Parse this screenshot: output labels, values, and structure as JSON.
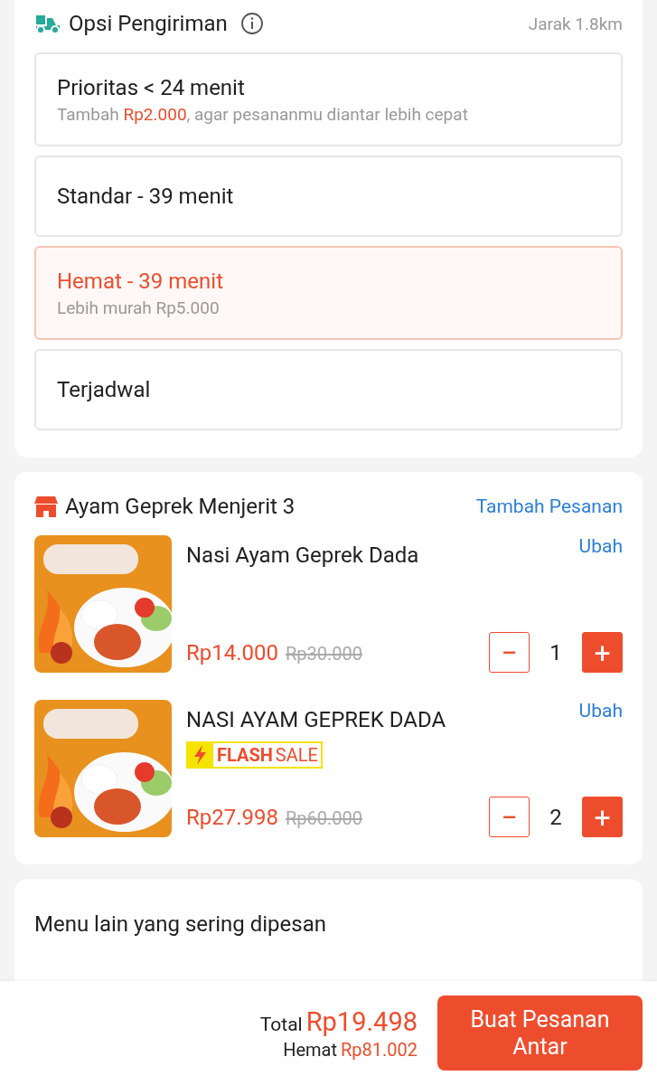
{
  "delivery": {
    "title": "Opsi Pengiriman",
    "distance": "Jarak 1.8km",
    "options": [
      {
        "title": "Prioritas < 24 menit",
        "subtitle": "Tambah **Rp2.000**, agar pesananmu diantar lebih cepat",
        "selected": false
      },
      {
        "title": "Standar - 39 menit",
        "selected": false
      },
      {
        "title": "Hemat - 39 menit",
        "subtitle": "Lebih murah Rp5.000",
        "selected": true
      },
      {
        "title": "Terjadwal",
        "selected": false
      }
    ]
  },
  "store": {
    "name": "Ayam Geprek Menjerit 3",
    "add_link": "Tambah Pesanan",
    "items": [
      {
        "name": "Nasi Ayam Geprek Dada",
        "edit": "Ubah",
        "flash_sale": false,
        "price": "Rp14.000",
        "original_price": "Rp30.000",
        "quantity": "1",
        "minus": "−",
        "plus": "+"
      },
      {
        "name": "NASI AYAM GEPREK DADA",
        "edit": "Ubah",
        "flash_sale": true,
        "flash_label": "FLASH",
        "flash_label_2": "SALE",
        "price": "Rp27.998",
        "original_price": "Rp60.000",
        "quantity": "2",
        "minus": "−",
        "plus": "+"
      }
    ]
  },
  "other_menu": {
    "title": "Menu lain yang sering dipesan"
  },
  "footer": {
    "total_label": "Total",
    "total": "Rp19.498",
    "savings_label": "Hemat",
    "savings": "Rp81.002",
    "button": "Buat Pesanan Antar"
  }
}
